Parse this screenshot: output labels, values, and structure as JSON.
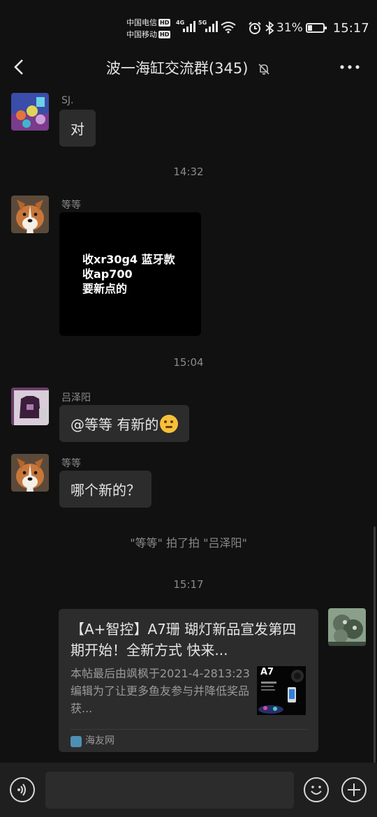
{
  "status_bar": {
    "carrier1": "中国电信",
    "carrier2": "中国移动",
    "hd_badge": "HD",
    "net1": "4G",
    "net2": "5G",
    "battery": "31%",
    "time": "15:17"
  },
  "header": {
    "title": "波一海缸交流群(345)"
  },
  "messages": [
    {
      "sender": "SJ.",
      "text": "对"
    },
    {
      "time": "14:32"
    },
    {
      "sender": "等等",
      "image_lines": [
        "收xr30g4  蓝牙款",
        "收ap700",
        "要新点的"
      ]
    },
    {
      "time": "15:04"
    },
    {
      "sender": "吕泽阳",
      "text": "@等等  有新的"
    },
    {
      "sender": "等等",
      "text": "哪个新的？"
    },
    {
      "system": "\"等等\" 拍了拍 \"吕泽阳\""
    },
    {
      "time": "15:17"
    }
  ],
  "card": {
    "title": "【A+智控】A7珊 瑚灯新品宣发第四期开始！全新方式  快来...",
    "description": "本帖最后由飒枫于2021-4-2813:23编辑为了让更多鱼友参与并降低奖品获...",
    "thumb_label": "A7",
    "source": "海友网"
  },
  "input": {
    "value": ""
  },
  "icons": [
    "back-icon",
    "mute-icon",
    "more-icon",
    "voice-icon",
    "emoji-icon",
    "plus-icon"
  ],
  "colors": {
    "background": "#111111",
    "bubble": "#2c2c2c",
    "secondary_text": "#8a8a8a"
  }
}
